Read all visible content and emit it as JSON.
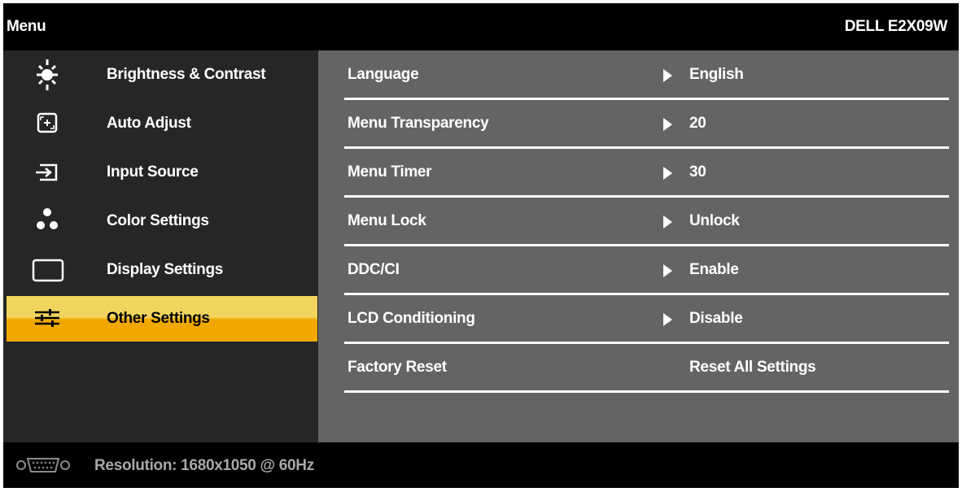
{
  "header": {
    "menu_title": "Menu",
    "model": "DELL E2X09W"
  },
  "sidebar": {
    "items": [
      {
        "label": "Brightness & Contrast",
        "icon": "brightness-icon",
        "selected": false
      },
      {
        "label": "Auto Adjust",
        "icon": "auto-adjust-icon",
        "selected": false
      },
      {
        "label": "Input Source",
        "icon": "input-source-icon",
        "selected": false
      },
      {
        "label": "Color Settings",
        "icon": "color-settings-icon",
        "selected": false
      },
      {
        "label": "Display Settings",
        "icon": "display-settings-icon",
        "selected": false
      },
      {
        "label": "Other Settings",
        "icon": "sliders-icon",
        "selected": true
      }
    ]
  },
  "settings": {
    "rows": [
      {
        "label": "Language",
        "value": "English",
        "has_arrow": true
      },
      {
        "label": "Menu Transparency",
        "value": "20",
        "has_arrow": true
      },
      {
        "label": "Menu Timer",
        "value": "30",
        "has_arrow": true
      },
      {
        "label": "Menu Lock",
        "value": "Unlock",
        "has_arrow": true
      },
      {
        "label": "DDC/CI",
        "value": "Enable",
        "has_arrow": true
      },
      {
        "label": "LCD Conditioning",
        "value": "Disable",
        "has_arrow": true
      },
      {
        "label": "Factory Reset",
        "value": "Reset All Settings",
        "has_arrow": false
      }
    ]
  },
  "footer": {
    "icon": "vga-connector-icon",
    "resolution_text": "Resolution: 1680x1050 @ 60Hz"
  },
  "colors": {
    "background": "#000000",
    "sidebar": "#262626",
    "content": "#646464",
    "selected_top": "#f2d55e",
    "selected_bottom": "#f0a800",
    "footer_text": "#a8a8a8"
  }
}
